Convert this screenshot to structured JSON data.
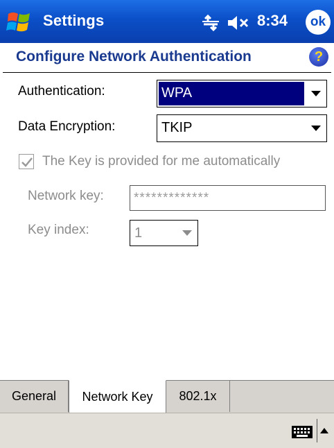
{
  "titlebar": {
    "title": "Settings",
    "clock": "8:34",
    "ok_label": "ok",
    "connectivity_icon": "connectivity-arrows-icon",
    "volume_icon": "speaker-muted-icon"
  },
  "header": {
    "title": "Configure Network Authentication",
    "help_label": "?"
  },
  "form": {
    "authentication": {
      "label": "Authentication:",
      "value": "WPA"
    },
    "data_encryption": {
      "label": "Data Encryption:",
      "value": "TKIP"
    },
    "auto_key": {
      "label": "The Key is provided for me automatically",
      "checked": true
    },
    "network_key": {
      "label": "Network key:",
      "value": "*************"
    },
    "key_index": {
      "label": "Key index:",
      "value": "1"
    }
  },
  "tabs": [
    {
      "label": "General",
      "active": false
    },
    {
      "label": "Network Key",
      "active": true
    },
    {
      "label": "802.1x",
      "active": false
    }
  ],
  "colors": {
    "titlebar_blue": "#0b4fc7",
    "header_text": "#1a3a8f",
    "selection": "#00007f",
    "disabled_text": "#8c8c8c"
  }
}
